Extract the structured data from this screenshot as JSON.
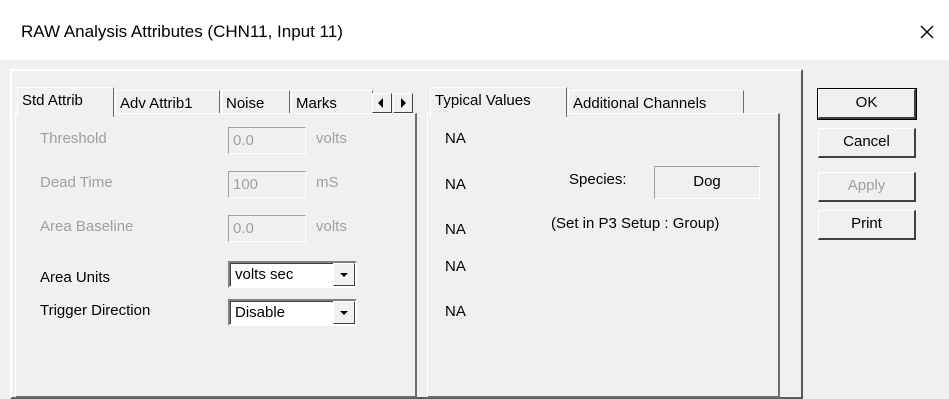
{
  "window": {
    "title": "RAW Analysis Attributes  (CHN11, Input 11)",
    "close_icon": "close-icon"
  },
  "left_tabs": {
    "tabs": [
      "Std Attrib",
      "Adv Attrib1",
      "Noise",
      "Marks"
    ],
    "active": "Std Attrib",
    "scroll_left_icon": "triangle-left-icon",
    "scroll_right_icon": "triangle-right-icon"
  },
  "std_attrib": {
    "threshold": {
      "label": "Threshold",
      "value": "0.0",
      "unit": "volts"
    },
    "dead_time": {
      "label": "Dead Time",
      "value": "100",
      "unit": "mS"
    },
    "area_baseline": {
      "label": "Area Baseline",
      "value": "0.0",
      "unit": "volts"
    },
    "area_units": {
      "label": "Area Units",
      "value": "volts sec"
    },
    "trigger_direction": {
      "label": "Trigger Direction",
      "value": "Disable"
    }
  },
  "right_tabs": {
    "tabs": [
      "Typical Values",
      "Additional Channels"
    ],
    "active": "Typical Values"
  },
  "typical_values": {
    "values": [
      "NA",
      "NA",
      "NA",
      "NA",
      "NA"
    ],
    "species_label": "Species:",
    "species_value": "Dog",
    "species_note": "(Set in P3 Setup : Group)"
  },
  "buttons": {
    "ok": "OK",
    "cancel": "Cancel",
    "apply": "Apply",
    "print": "Print"
  }
}
